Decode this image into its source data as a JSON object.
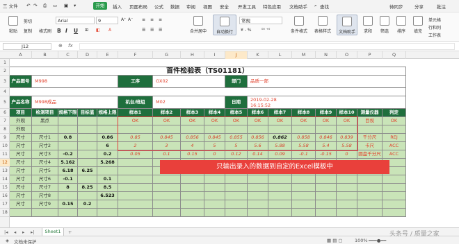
{
  "titlebar": {
    "file_menu": "三 文件",
    "tabs": [
      "开始",
      "插入",
      "页面布局",
      "公式",
      "数据",
      "审阅",
      "视图",
      "安全",
      "开发工具",
      "特色应用",
      "文档助手"
    ],
    "search": "查找",
    "right": [
      "待同步",
      "分享",
      "批注"
    ]
  },
  "ribbon": {
    "paste": "粘贴",
    "cut": "剪切",
    "copy": "复制",
    "format_painter": "格式刷",
    "font_name": "Arial",
    "font_size": "9",
    "bold": "B",
    "italic": "I",
    "underline": "U",
    "merge_center": "合并居中",
    "auto_wrap": "自动换行",
    "number_format": "常规",
    "conditional_format": "条件格式",
    "table_style": "表格样式",
    "doc_helper": "文档助手",
    "sum": "求和",
    "filter": "筛选",
    "sort": "排序",
    "fill": "填充",
    "cell_format": "单元格",
    "row_col": "行和列",
    "worksheet": "工作表"
  },
  "formula_bar": {
    "cell_ref": "J12",
    "fx": "fx"
  },
  "columns": [
    "A",
    "B",
    "C",
    "D",
    "E",
    "F",
    "G",
    "H",
    "I",
    "J",
    "K",
    "L",
    "M",
    "N",
    "O",
    "P",
    "Q"
  ],
  "rows": [
    "1",
    "2",
    "3",
    "4",
    "5",
    "6",
    "7",
    "8",
    "9",
    "10",
    "11",
    "12",
    "13",
    "14",
    "15",
    "16",
    "17",
    "18"
  ],
  "sheet": {
    "title": "首件检验表（TS01181）",
    "labels": {
      "product_no": "产品图号",
      "product_name": "产品名称",
      "process": "工序",
      "machine_team": "机台/班组",
      "department": "部门",
      "date": "日期"
    },
    "values": {
      "product_no": "M998",
      "product_name": "M998成品",
      "process": "GX02",
      "machine_team": "M02",
      "department": "品质一部",
      "date": "2019-02-28\n16:15:52"
    },
    "headers": [
      "项目",
      "检测项目",
      "规格下限",
      "目标值",
      "规格上限",
      "样本1",
      "样本2",
      "样本3",
      "样本4",
      "样本5",
      "样本6",
      "样本7",
      "样本8",
      "样本9",
      "样本10",
      "测量仪器",
      "判定"
    ],
    "data_rows": [
      [
        "外观",
        "黑点",
        "",
        "",
        "",
        "OK",
        "OK",
        "OK",
        "OK",
        "OK",
        "OK",
        "OK",
        "OK",
        "OK",
        "OK",
        "目视",
        "OK"
      ],
      [
        "外观",
        "",
        "",
        "",
        "",
        "",
        "",
        "",
        "",
        "",
        "",
        "",
        "",
        "",
        "",
        "",
        ""
      ],
      [
        "尺寸",
        "尺寸1",
        "0.8",
        "",
        "0.86",
        "0.85",
        "0.845",
        "0.856",
        "0.845",
        "0.855",
        "0.856",
        "0.862",
        "0.858",
        "0.846",
        "0.839",
        "千分尺",
        "REJ"
      ],
      [
        "尺寸",
        "尺寸2",
        "",
        "",
        "6",
        "2",
        "3",
        "4",
        "5",
        "5",
        "5.6",
        "5.88",
        "5.58",
        "5.4",
        "5.58",
        "卡尺",
        "ACC"
      ],
      [
        "尺寸",
        "尺寸3",
        "-0.2",
        "",
        "0.2",
        "0.05",
        "0.1",
        "0.15",
        "0",
        "0.12",
        "0.14",
        "0.09",
        "-0.1",
        "-0.15",
        "0",
        "圆盘千分尺",
        "ACC"
      ],
      [
        "尺寸",
        "尺寸4",
        "5.162",
        "",
        "5.268",
        "",
        "",
        "",
        "",
        "",
        "",
        "",
        "",
        "",
        "",
        "",
        ""
      ],
      [
        "尺寸",
        "尺寸5",
        "6.18",
        "6.25",
        "",
        "",
        "",
        "",
        "",
        "",
        "",
        "",
        "",
        "",
        "",
        "",
        ""
      ],
      [
        "尺寸",
        "尺寸6",
        "-0.1",
        "",
        "0.1",
        "",
        "",
        "",
        "",
        "",
        "",
        "",
        "",
        "",
        "",
        "",
        ""
      ],
      [
        "尺寸",
        "尺寸7",
        "8",
        "8.25",
        "8.5",
        "",
        "",
        "",
        "",
        "",
        "",
        "",
        "",
        "",
        "",
        "",
        ""
      ],
      [
        "尺寸",
        "尺寸8",
        "",
        "",
        "6.523",
        "",
        "",
        "",
        "",
        "",
        "",
        "",
        "",
        "",
        "",
        "",
        ""
      ],
      [
        "尺寸",
        "尺寸9",
        "0.15",
        "0.2",
        "",
        "",
        "",
        "",
        "",
        "",
        "",
        "",
        "",
        "",
        "",
        "",
        ""
      ]
    ]
  },
  "banner": "只输出录入的数据到自定的Excel模板中",
  "sheet_tabs": [
    "Sheet1",
    "+"
  ],
  "status": {
    "left": "文档未保护",
    "zoom": "100%"
  },
  "watermark": "头条号 / 质量之家"
}
